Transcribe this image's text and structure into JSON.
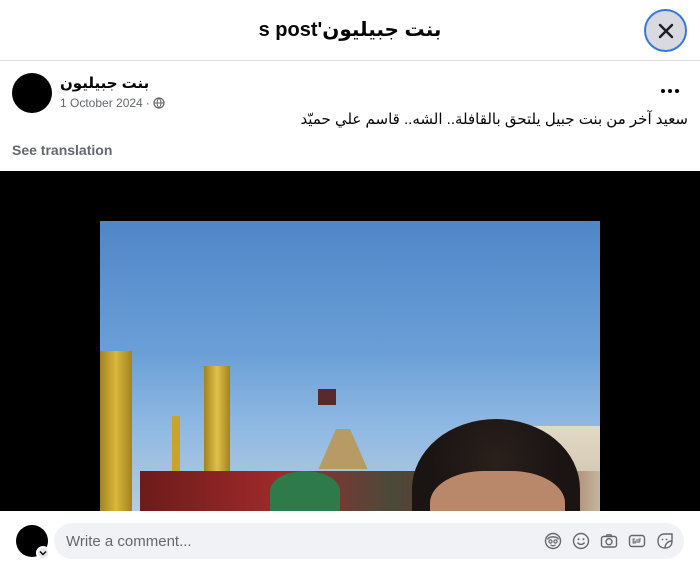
{
  "header": {
    "title": "بنت جبيليون's post"
  },
  "post": {
    "author": "بنت جبيليون",
    "date": "1 October 2024",
    "separator": "·",
    "text": "سعيد آخر من بنت جبيل يلتحق بالقافلة..  الشه.. قاسم علي حميّد",
    "see_translation": "See translation",
    "more_label": "···"
  },
  "comment": {
    "placeholder": "Write a comment..."
  },
  "icons": {
    "close": "close-icon",
    "globe": "globe-icon",
    "more": "more-icon",
    "avatar_sticker": "avatar-sticker-icon",
    "emoji": "emoji-icon",
    "camera": "camera-icon",
    "gif": "gif-icon",
    "sticker": "sticker-icon"
  },
  "colors": {
    "focus_ring": "#3578e5",
    "muted_text": "#65676b",
    "input_bg": "#f0f2f5"
  }
}
